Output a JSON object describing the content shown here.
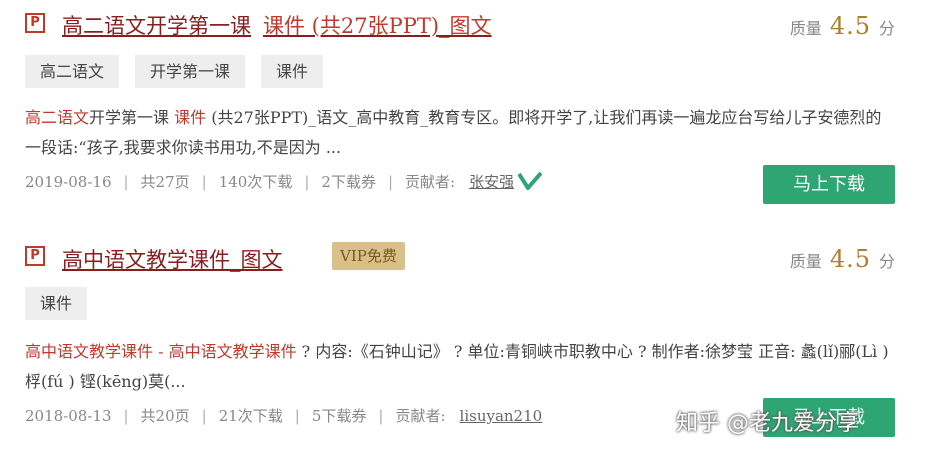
{
  "results": [
    {
      "icon": "P",
      "title_main": "高二语文开学第一课",
      "title_highlight": "课件 (共27张PPT)_图文",
      "quality_label": "质量",
      "quality_score": "4.5",
      "quality_unit": "分",
      "tags": [
        "高二语文",
        "开学第一课",
        "课件"
      ],
      "snippet_red1": "高二语文",
      "snippet_plain1": "开学第一课 ",
      "snippet_red2": "课件",
      "snippet_plain2": " (共27张PPT)_语文_高中教育_教育专区。即将开学了,让我们再读一遍龙应台写给儿子安德烈的一段话:“孩子,我要求你读书用功,不是因为 ...",
      "date": "2019-08-16",
      "pages": "共27页",
      "downloads": "140次下载",
      "coupons": "2下载券",
      "contributor_label": "贡献者:",
      "contributor": "张安强",
      "download_button": "马上下载"
    },
    {
      "icon": "P",
      "title_main": "高中语文教学课件_图文",
      "vip_badge": "VIP免费",
      "quality_label": "质量",
      "quality_score": "4.5",
      "quality_unit": "分",
      "tags": [
        "课件"
      ],
      "snippet_red1": "高中语文教学课件 - 高中语文教学课件",
      "snippet_plain1": " ? 内容:《石钟山记》 ? 单位:青铜峡市职教中心 ? 制作者:徐梦莹 正音: 蠡(lǐ)郦(Lì )桴(fú ) 铿(kēng)莫(...",
      "date": "2018-08-13",
      "pages": "共20页",
      "downloads": "21次下载",
      "coupons": "5下载券",
      "contributor_label": "贡献者:",
      "contributor": "lisuyan210",
      "download_button": "马上下载"
    }
  ],
  "watermark": "知乎 @老九爱分享",
  "colors": {
    "title": "#8a1e1e",
    "highlight": "#c0392b",
    "score": "#b07e2a",
    "button": "#2ea673",
    "vip": "#d9c08a",
    "verified": "#2ea673"
  }
}
